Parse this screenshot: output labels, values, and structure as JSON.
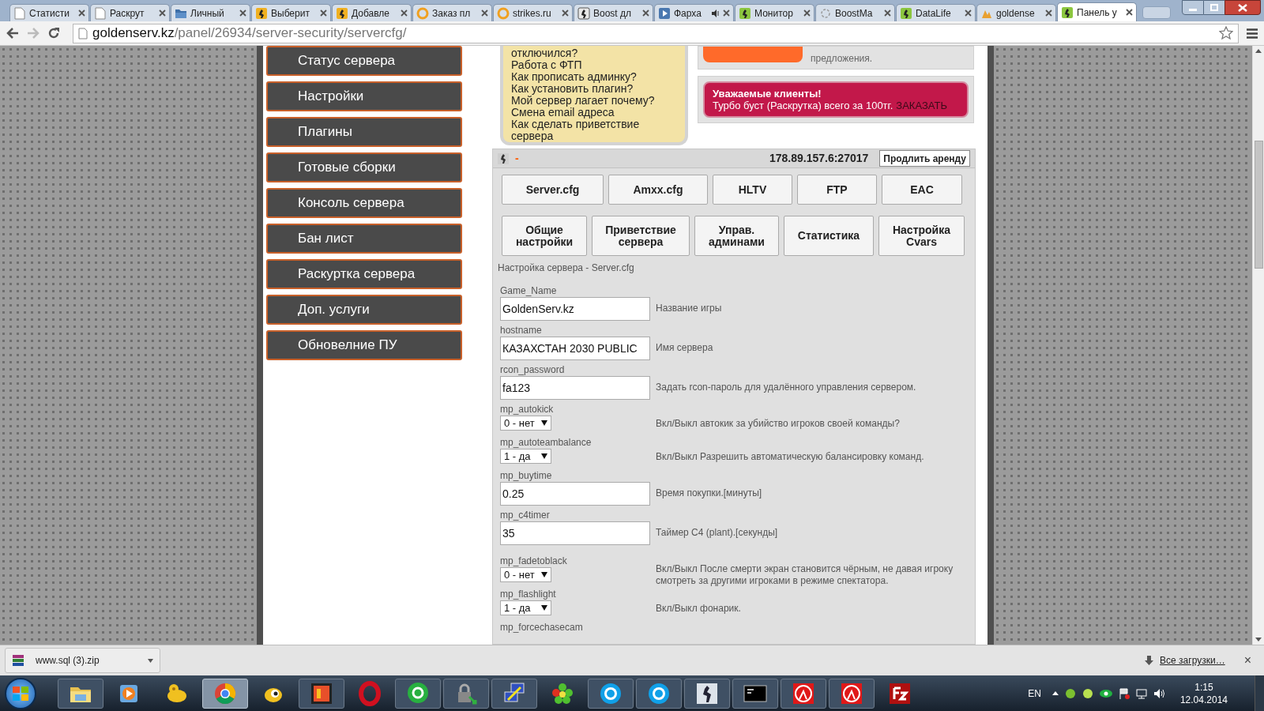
{
  "tabs": [
    {
      "title": "Статисти",
      "selected": false
    },
    {
      "title": "Раскрут",
      "selected": false
    },
    {
      "title": "Личный",
      "selected": false
    },
    {
      "title": "Выберит",
      "selected": false
    },
    {
      "title": "Добавле",
      "selected": false
    },
    {
      "title": "Заказ пл",
      "selected": false
    },
    {
      "title": "strikes.ru",
      "selected": false
    },
    {
      "title": "Boost дл",
      "selected": false
    },
    {
      "title": "Фарха",
      "selected": false
    },
    {
      "title": "Монитор",
      "selected": false
    },
    {
      "title": "BoostMa",
      "selected": false
    },
    {
      "title": "DataLife",
      "selected": false
    },
    {
      "title": "goldense",
      "selected": false
    },
    {
      "title": "Панель у",
      "selected": true
    }
  ],
  "address_bar": {
    "host": "goldenserv.kz",
    "path": "/panel/26934/server-security/servercfg/"
  },
  "sidebar": {
    "items": [
      "Статус сервера",
      "Настройки",
      "Плагины",
      "Готовые сборки",
      "Консоль сервера",
      "Бан лист",
      "Раскуртка сервера",
      "Доп. услуги",
      "Обновелние ПУ"
    ]
  },
  "faq": {
    "items": [
      "отключился?",
      "Работа с ФТП",
      "Как прописать админку?",
      "Как установить плагин?",
      "Мой сервер лагает почему?",
      "Смена email адреса",
      "Как сделать приветствие сервера"
    ]
  },
  "notice": {
    "text": "предложения."
  },
  "banner": {
    "title": "Уважаемые клиенты!",
    "text": "Турбо буст (Раскрутка) всего за 100тг.",
    "link": "ЗАКАЗАТЬ"
  },
  "server": {
    "status": "-",
    "address": "178.89.157.6:27017",
    "renew_button": "Продлить аренду"
  },
  "config_tabs": [
    "Server.cfg",
    "Amxx.cfg",
    "HLTV",
    "FTP",
    "EAC"
  ],
  "section_tabs": [
    "Общие настройки",
    "Приветствие сервера",
    "Управ. админами",
    "Статистика",
    "Настройка Cvars"
  ],
  "section_title": "Настройка сервера - Server.cfg",
  "settings": [
    {
      "name": "Game_Name",
      "kind": "text",
      "value": "GoldenServ.kz",
      "description": "Название игры"
    },
    {
      "name": "hostname",
      "kind": "text",
      "value": "КАЗАХСТАН 2030 PUBLIC",
      "description": "Имя сервера"
    },
    {
      "name": "rcon_password",
      "kind": "text",
      "value": "fa123",
      "description": "Задать rcon-пароль для удалённого управления сервером."
    },
    {
      "name": "mp_autokick",
      "kind": "select",
      "value": "0 - нет",
      "description": "Вкл/Выкл автокик за убийство игроков своей команды?"
    },
    {
      "name": "mp_autoteambalance",
      "kind": "select",
      "value": "1 - да",
      "description": "Вкл/Выкл Разрешить автоматическую балансировку команд."
    },
    {
      "name": "mp_buytime",
      "kind": "text",
      "value": "0.25",
      "description": "Время покупки.[минуты]"
    },
    {
      "name": "mp_c4timer",
      "kind": "text",
      "value": "35",
      "description": "Таймер C4 (plant).[секунды]"
    },
    {
      "name": "mp_fadetoblack",
      "kind": "select",
      "value": "0 - нет",
      "description": "Вкл/Выкл После смерти экран становится чёрным, не давая игроку смотреть за другими игроками в режиме спектатора."
    },
    {
      "name": "mp_flashlight",
      "kind": "select",
      "value": "1 - да",
      "description": "Вкл/Выкл фонарик."
    },
    {
      "name": "mp_forcechasecam",
      "kind": "label"
    }
  ],
  "downloads": {
    "items": [
      {
        "file": "www.sql (3).zip"
      }
    ],
    "all_link": "Все загрузки…",
    "close": "×"
  },
  "tray": {
    "language": "EN",
    "time": "1:15",
    "date": "12.04.2014"
  }
}
